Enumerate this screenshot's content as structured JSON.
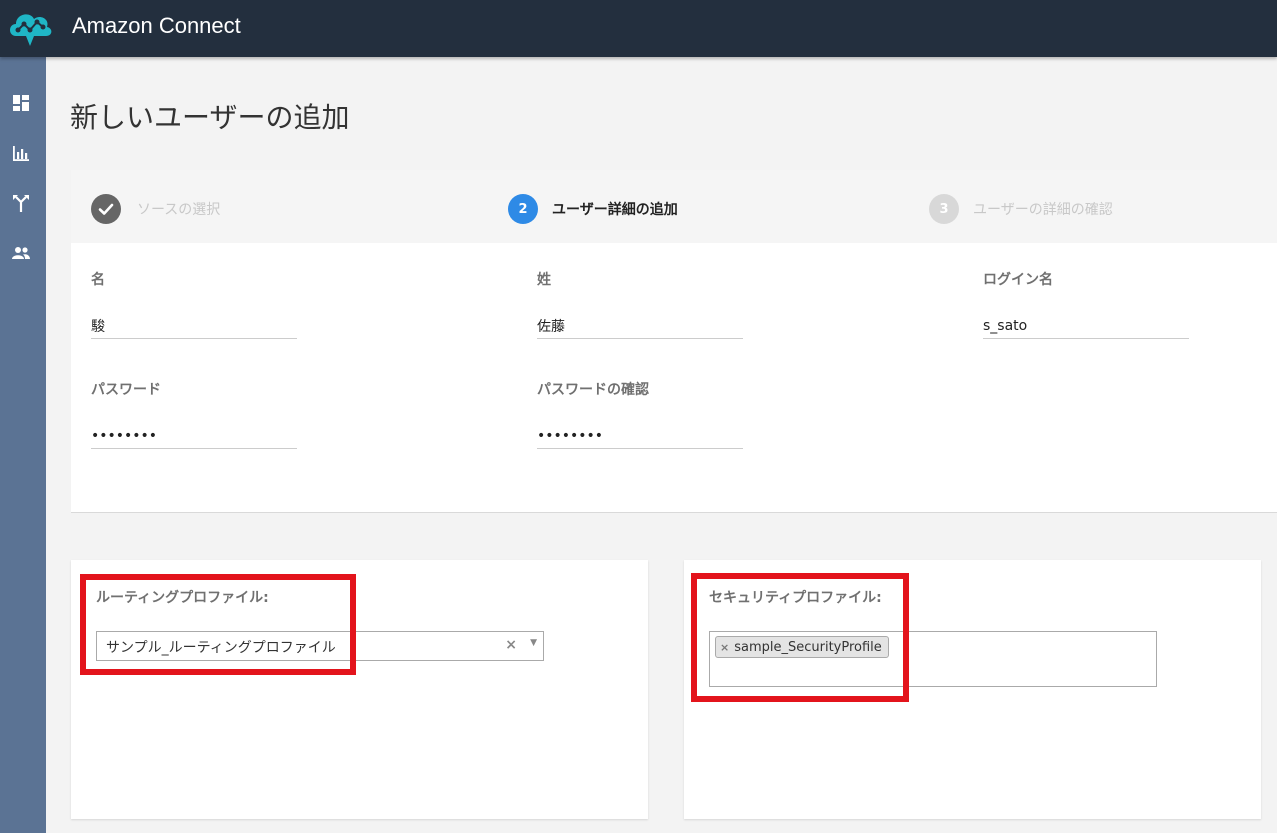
{
  "app": {
    "title": "Amazon Connect"
  },
  "sidebar": {
    "items": [
      {
        "icon": "dashboard-icon"
      },
      {
        "icon": "bar-chart-icon"
      },
      {
        "icon": "routing-icon"
      },
      {
        "icon": "users-icon"
      }
    ]
  },
  "page": {
    "title": "新しいユーザーの追加"
  },
  "stepper": {
    "steps": [
      {
        "number": "",
        "label": "ソースの選択",
        "state": "completed"
      },
      {
        "number": "2",
        "label": "ユーザー詳細の追加",
        "state": "active"
      },
      {
        "number": "3",
        "label": "ユーザーの詳細の確認",
        "state": "pending"
      }
    ]
  },
  "form": {
    "first_name": {
      "label": "名",
      "value": "駿"
    },
    "last_name": {
      "label": "姓",
      "value": "佐藤"
    },
    "login": {
      "label": "ログイン名",
      "value": "s_sato"
    },
    "password": {
      "label": "パスワード",
      "value": "••••••••"
    },
    "password_confirm": {
      "label": "パスワードの確認",
      "value": "••••••••"
    }
  },
  "routing_profile": {
    "label": "ルーティングプロファイル:",
    "value": "サンプル_ルーティングプロファイル",
    "clear": "×",
    "arrow": "▼"
  },
  "security_profile": {
    "label": "セキュリティプロファイル:",
    "tags": [
      {
        "remove": "×",
        "text": "sample_SecurityProfile"
      }
    ]
  },
  "colors": {
    "topbar": "#232f3e",
    "sidebar": "#5b7394",
    "active_step": "#2e8ae6",
    "highlight": "#e3141c"
  }
}
